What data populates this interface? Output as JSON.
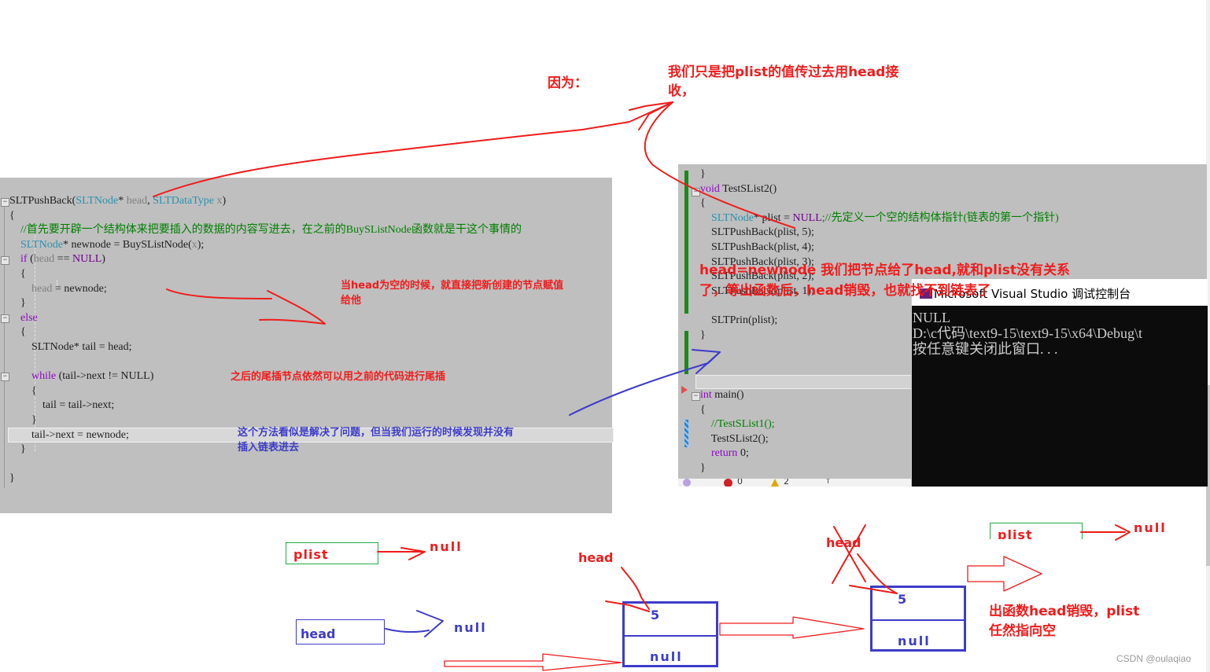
{
  "annotations": {
    "because": "因为：",
    "reason": "我们只是把plist的值传过去用head接",
    "reason_line2": "收，",
    "head_null": "当head为空的时候，就直接把新创建的节点赋值",
    "head_null_line2": "给他",
    "tail_insert": "之后的尾插节点依然可以用之前的代码进行尾插",
    "problem": "这个方法看似是解决了问题，但当我们运行的时候发现并没有",
    "problem_line2": "插入链表进去",
    "explanation": "head=newnode 我们把节点给了head,就和plist没有关系",
    "explanation_line2": "了，等出函数后，head销毁，也就找不到链表了",
    "conclusion": "出函数head销毁，plist",
    "conclusion_line2": "任然指向空"
  },
  "left_editor": {
    "lines": [
      {
        "parts": [
          [
            "fn",
            "SLTPushBack("
          ],
          [
            "ty",
            "SLTNode"
          ],
          [
            "fn",
            "* "
          ],
          [
            "param",
            "head"
          ],
          [
            "fn",
            ", "
          ],
          [
            "ty",
            "SLTDataType"
          ],
          [
            "fn",
            " "
          ],
          [
            "param",
            "x"
          ],
          [
            "fn",
            ")"
          ]
        ]
      },
      {
        "parts": [
          [
            "fn",
            "{"
          ]
        ]
      },
      {
        "parts": [
          [
            "cm",
            "    //首先要开辟一个结构体来把要插入的数据的内容写进去，在之前的BuySListNode函数就是干这个事情的"
          ]
        ]
      },
      {
        "parts": [
          [
            "ty",
            "    SLTNode"
          ],
          [
            "fn",
            "* newnode = BuySListNode("
          ],
          [
            "param",
            "x"
          ],
          [
            "fn",
            ");"
          ]
        ]
      },
      {
        "parts": [
          [
            "kw",
            "    if"
          ],
          [
            "fn",
            " ("
          ],
          [
            "param",
            "head"
          ],
          [
            "fn",
            " == "
          ],
          [
            "mac",
            "NULL"
          ],
          [
            "fn",
            ")"
          ]
        ]
      },
      {
        "parts": [
          [
            "fn",
            "    {"
          ]
        ]
      },
      {
        "parts": [
          [
            "param",
            "        head"
          ],
          [
            "fn",
            " = newnode;"
          ]
        ]
      },
      {
        "parts": [
          [
            "fn",
            "    }"
          ]
        ]
      },
      {
        "parts": [
          [
            "kw",
            "    else"
          ]
        ]
      },
      {
        "parts": [
          [
            "fn",
            "    {"
          ]
        ]
      },
      {
        "parts": [
          [
            "fn",
            "        SLTNode* tail = head;"
          ]
        ]
      },
      {
        "parts": [
          [
            "fn",
            ""
          ]
        ]
      },
      {
        "parts": [
          [
            "kw",
            "        while"
          ],
          [
            "fn",
            " (tail->next != NULL)"
          ]
        ]
      },
      {
        "parts": [
          [
            "fn",
            "        {"
          ]
        ]
      },
      {
        "parts": [
          [
            "fn",
            "            tail = tail->next;"
          ]
        ]
      },
      {
        "parts": [
          [
            "fn",
            "        }"
          ]
        ]
      },
      {
        "parts": [
          [
            "fn",
            "        tail->next = newnode;"
          ]
        ]
      },
      {
        "parts": [
          [
            "fn",
            "    }"
          ]
        ]
      },
      {
        "parts": [
          [
            "fn",
            ""
          ]
        ]
      },
      {
        "parts": [
          [
            "fn",
            "}"
          ]
        ]
      }
    ]
  },
  "right_editor": {
    "lines": [
      {
        "parts": [
          [
            "fn",
            "}"
          ]
        ]
      },
      {
        "parts": [
          [
            "kw",
            "void"
          ],
          [
            "fn",
            " TestSList2()"
          ]
        ]
      },
      {
        "parts": [
          [
            "fn",
            "{"
          ]
        ]
      },
      {
        "parts": [
          [
            "ty",
            "    SLTNode"
          ],
          [
            "fn",
            "* plist = "
          ],
          [
            "mac",
            "NULL"
          ],
          [
            "cm",
            ";//先定义一个空的结构体指针(链表的第一个指针)"
          ]
        ]
      },
      {
        "parts": [
          [
            "fn",
            "    SLTPushBack(plist, 5);"
          ]
        ]
      },
      {
        "parts": [
          [
            "fn",
            "    SLTPushBack(plist, 4);"
          ]
        ]
      },
      {
        "parts": [
          [
            "fn",
            "    SLTPushBack(plist, 3);"
          ]
        ]
      },
      {
        "parts": [
          [
            "fn",
            "    SLTPushBack(plist, 2);"
          ]
        ]
      },
      {
        "parts": [
          [
            "fn",
            "    SLTPushBack(plist, 1);"
          ]
        ]
      },
      {
        "parts": [
          [
            "fn",
            ""
          ]
        ]
      },
      {
        "parts": [
          [
            "fn",
            "    SLTPrin(plist);"
          ]
        ]
      },
      {
        "parts": [
          [
            "fn",
            "}"
          ]
        ]
      }
    ],
    "main_lines": [
      {
        "parts": [
          [
            "kw",
            "int"
          ],
          [
            "fn",
            " main()"
          ]
        ]
      },
      {
        "parts": [
          [
            "fn",
            "{"
          ]
        ]
      },
      {
        "parts": [
          [
            "cm",
            "    //TestSList1();"
          ]
        ]
      },
      {
        "parts": [
          [
            "fn",
            "    TestSList2();"
          ]
        ]
      },
      {
        "parts": [
          [
            "kw",
            "    return"
          ],
          [
            "fn",
            " 0;"
          ]
        ]
      },
      {
        "parts": [
          [
            "fn",
            "}"
          ]
        ]
      }
    ],
    "status": {
      "errors": "0",
      "warnings": "2"
    }
  },
  "console": {
    "title": "Microsoft Visual Studio 调试控制台",
    "output": [
      "NULL",
      "D:\\c代码\\text9-15\\text9-15\\x64\\Debug\\t",
      "按任意键关闭此窗口. . ."
    ]
  },
  "diagram": {
    "plist_label": "plist",
    "head_label": "head",
    "null_label": "null",
    "node_value": "5",
    "node_next": "null",
    "head_pointer_label": "head",
    "crossed_head_label": "head"
  },
  "watermark": "CSDN @oulaqiao",
  "colors": {
    "red": "#f01c1c",
    "blue": "#3c3cc8",
    "green": "#22aa44",
    "editor_bg": "#bfbfbf",
    "console_bg": "#0c0c0c"
  }
}
